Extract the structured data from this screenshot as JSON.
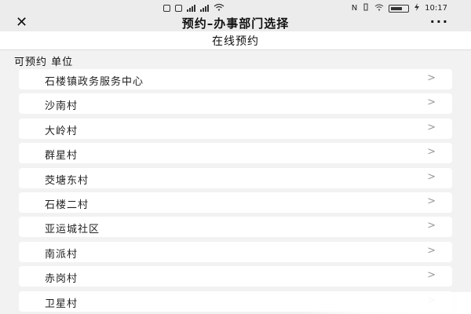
{
  "status_bar": {
    "left_signal_1": "⁴ᴳ",
    "left_signal_2": "⁴ᴳ",
    "nfc": "N",
    "time": "10:17"
  },
  "nav": {
    "close_glyph": "✕",
    "title": "预约–办事部门选择",
    "more_glyph": "···"
  },
  "sub_header": {
    "title": "在线预约"
  },
  "section": {
    "label": "可预约 单位"
  },
  "list": {
    "arrow": ">",
    "items": [
      {
        "label": "石楼镇政务服务中心"
      },
      {
        "label": "沙南村"
      },
      {
        "label": "大岭村"
      },
      {
        "label": "群星村"
      },
      {
        "label": "茭塘东村"
      },
      {
        "label": "石楼二村"
      },
      {
        "label": "亚运城社区"
      },
      {
        "label": "南派村"
      },
      {
        "label": "赤岗村"
      },
      {
        "label": "卫星村"
      }
    ]
  },
  "colors": {
    "background": "#f2f2f2",
    "nav_background": "#ececec",
    "card": "#ffffff",
    "arrow": "#9a9a9a"
  },
  "icons": [
    "close-icon",
    "more-icon",
    "chevron-right-icon",
    "wifi-icon",
    "battery-icon",
    "signal-icon"
  ]
}
